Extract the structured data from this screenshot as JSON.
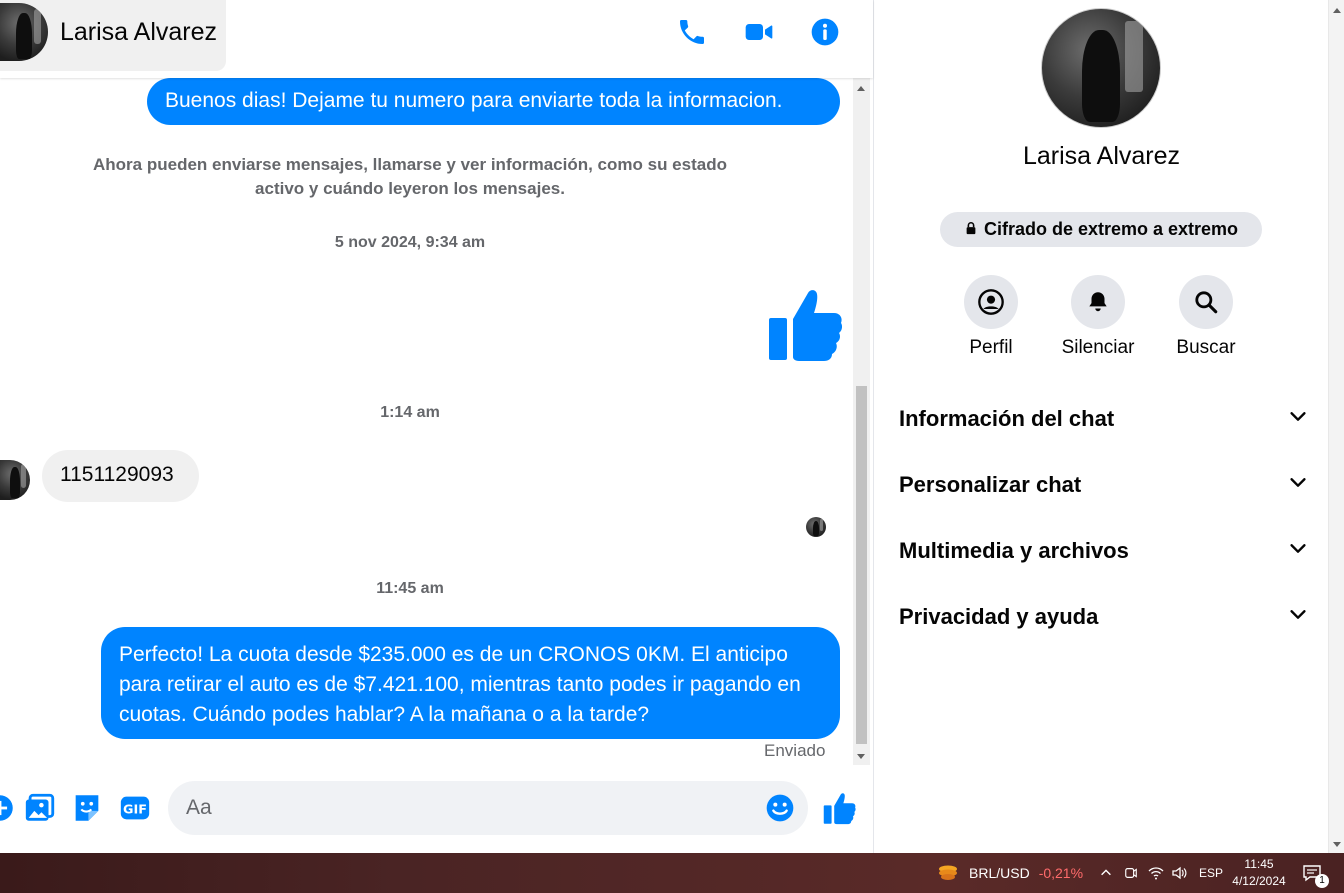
{
  "header": {
    "contact_name": "Larisa Alvarez"
  },
  "messages": {
    "out_1": "Buenos dias! Dejame tu numero para enviarte toda la informacion.",
    "system_note": "Ahora pueden enviarse mensajes, llamarse y ver información, como su estado activo y cuándo leyeron los mensajes.",
    "ts_1": "5 nov 2024, 9:34 am",
    "ts_2": "1:14 am",
    "in_1": "1151129093",
    "ts_3": "11:45 am",
    "out_2": "Perfecto! La cuota desde $235.000 es de un CRONOS 0KM. El anticipo para retirar el auto es de $7.421.100, mientras tanto podes ir pagando en cuotas. Cuándo podes hablar? A la mañana o a la tarde?",
    "status": "Enviado"
  },
  "composer": {
    "placeholder": "Aa"
  },
  "info_panel": {
    "name": "Larisa Alvarez",
    "encryption_label": "Cifrado de extremo a extremo",
    "actions": [
      {
        "label": "Perfil"
      },
      {
        "label": "Silenciar"
      },
      {
        "label": "Buscar"
      }
    ],
    "sections": [
      {
        "label": "Información del chat"
      },
      {
        "label": "Personalizar chat"
      },
      {
        "label": "Multimedia y archivos"
      },
      {
        "label": "Privacidad y ayuda"
      }
    ]
  },
  "taskbar": {
    "ticker": "BRL/USD",
    "change": "-0,21%",
    "language": "ESP",
    "time": "11:45",
    "date": "4/12/2024",
    "notification_count": "1"
  },
  "colors": {
    "accent": "#0084ff",
    "bubble_in": "#f0f0f0",
    "secondary_text": "#65676b",
    "negative": "#ff6b6b"
  }
}
